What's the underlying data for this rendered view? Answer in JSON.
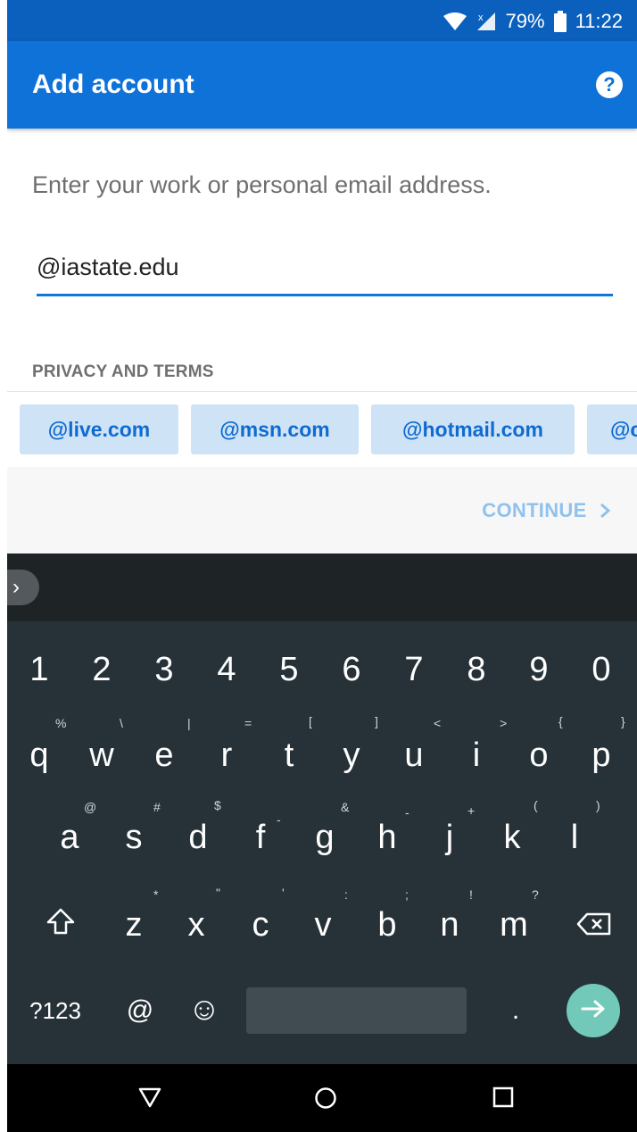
{
  "status_bar": {
    "battery": "79%",
    "time": "11:22"
  },
  "app_bar": {
    "title": "Add account",
    "help_icon": "?"
  },
  "form": {
    "prompt": "Enter your work or personal email address.",
    "email_value": "@iastate.edu",
    "privacy_label": "PRIVACY AND TERMS"
  },
  "suggestions": [
    "@live.com",
    "@msn.com",
    "@hotmail.com",
    "@c"
  ],
  "continue_label": "CONTINUE",
  "keyboard": {
    "expand_icon": "›",
    "numbers": [
      "1",
      "2",
      "3",
      "4",
      "5",
      "6",
      "7",
      "8",
      "9",
      "0"
    ],
    "row1": [
      "q",
      "w",
      "e",
      "r",
      "t",
      "y",
      "u",
      "i",
      "o",
      "p"
    ],
    "row1_hints": [
      "%",
      "\\",
      "|",
      "=",
      "[",
      "]",
      "<",
      ">",
      "{",
      "}"
    ],
    "row2": [
      "a",
      "s",
      "d",
      "f",
      "g",
      "h",
      "j",
      "k",
      "l"
    ],
    "row2_hints": [
      "@",
      "#",
      "$",
      "-",
      "&",
      "-",
      "+",
      "(",
      ")"
    ],
    "row3": [
      "z",
      "x",
      "c",
      "v",
      "b",
      "n",
      "m"
    ],
    "row3_hints": [
      "*",
      "\"",
      "'",
      ":",
      ";",
      "!",
      "?"
    ],
    "symbols_label": "?123",
    "at_label": "@",
    "emoji_icon": "☺",
    "period_label": "."
  },
  "colors": {
    "accent": "#0f72d8",
    "status_bar": "#0b5fbd",
    "chip_bg": "#cfe3f6",
    "keyboard_bg": "#263238",
    "enter": "#73c9b9"
  }
}
